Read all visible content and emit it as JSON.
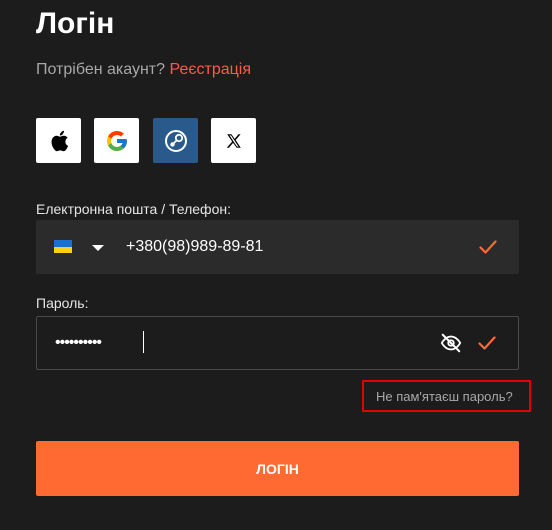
{
  "login_title": "Логін",
  "signup_prompt": {
    "text": "Потрібен акаунт?",
    "link_label": "Реєстрація",
    "link_color": "#ff5a4a"
  },
  "social_buttons": [
    {
      "icon": "apple-icon",
      "label": "Apple"
    },
    {
      "icon": "google-icon",
      "label": "Google"
    },
    {
      "icon": "steam-icon",
      "label": "Steam"
    },
    {
      "icon": "x-icon",
      "label": "X"
    }
  ],
  "email_phone_field": {
    "label": "Електронна пошта / Телефон:",
    "country_flag": "ukraine-flag-icon",
    "value": "+380(98)989-89-81",
    "valid": true
  },
  "password_field": {
    "label": "Пароль:",
    "value": "••••••••••",
    "visibility_icon": "eye-off-icon",
    "valid": true
  },
  "forgot_password": {
    "label": "Не пам'ятаєш пароль?",
    "highlight_color": "#e00000"
  },
  "login_button": {
    "label": "ЛОГІН",
    "color": "#ff6a33"
  },
  "colors": {
    "background": "#1c1c1c",
    "accent": "#ff6a33",
    "check": "#ff6a33"
  }
}
